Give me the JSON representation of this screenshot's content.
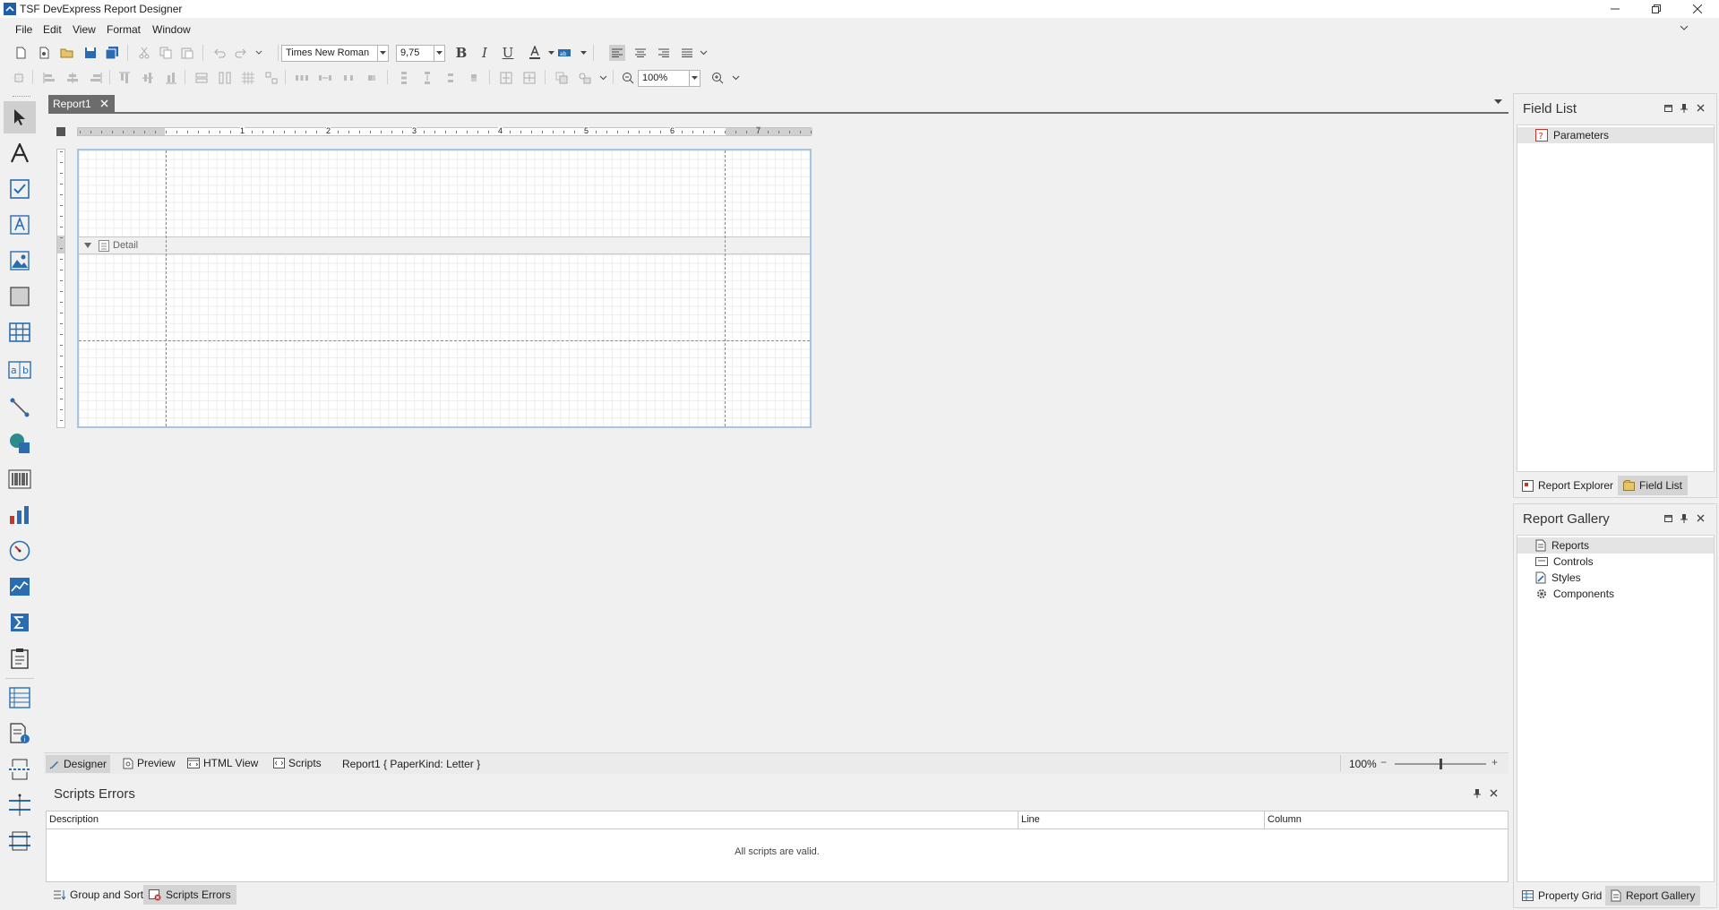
{
  "window": {
    "title": "TSF DevExpress Report Designer"
  },
  "menu": [
    "File",
    "Edit",
    "View",
    "Format",
    "Window"
  ],
  "toolbar": {
    "font_name": "Times New Roman",
    "font_size": "9,75",
    "zoom": "100%"
  },
  "document": {
    "tab_label": "Report1",
    "ruler_marks": [
      "1",
      "2",
      "3",
      "4",
      "5",
      "6",
      "7"
    ],
    "band_label": "Detail"
  },
  "designer_bar": {
    "tabs": [
      "Designer",
      "Preview",
      "HTML View",
      "Scripts"
    ],
    "report_info": "Report1 { PaperKind: Letter }",
    "zoom_label": "100%",
    "zoom_minus": "−",
    "zoom_plus": "+",
    "zoom_fraction": 0.5
  },
  "scripts_errors": {
    "title": "Scripts Errors",
    "columns": [
      "Description",
      "Line",
      "Column"
    ],
    "message": "All scripts are valid."
  },
  "bottom_tabs": [
    "Group and Sort",
    "Scripts Errors"
  ],
  "field_list": {
    "title": "Field List",
    "items": [
      "Parameters"
    ],
    "tabs": [
      "Report Explorer",
      "Field List"
    ]
  },
  "report_gallery": {
    "title": "Report Gallery",
    "items": [
      "Reports",
      "Controls",
      "Styles",
      "Components"
    ],
    "tabs": [
      "Property Grid",
      "Report Gallery"
    ]
  },
  "colors": {
    "accent_blue": "#2b6cb0",
    "selection_border": "#a9c4de",
    "tab_dark": "#6c6c6c"
  }
}
